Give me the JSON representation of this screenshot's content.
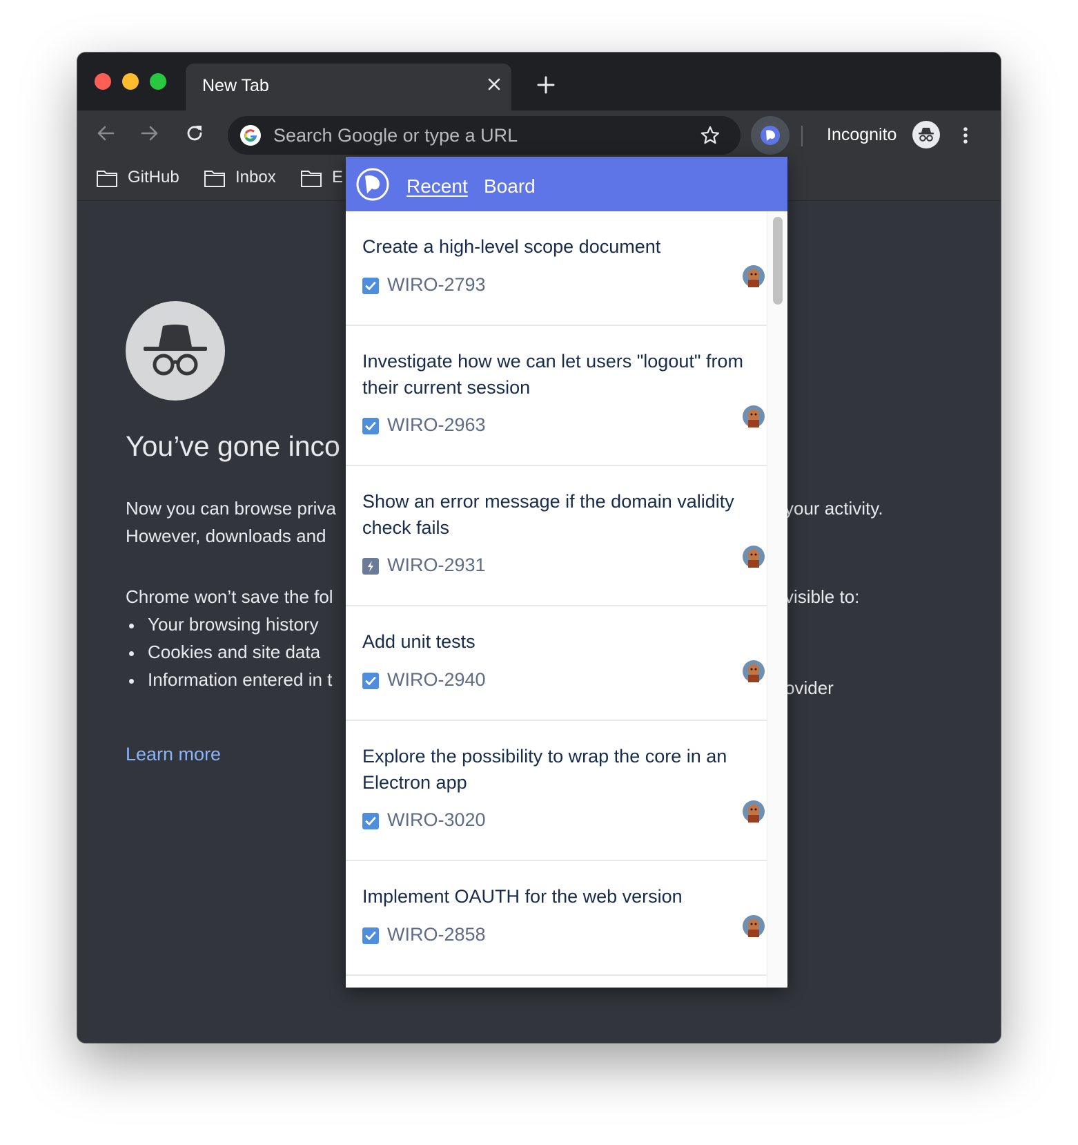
{
  "browser": {
    "tab_title": "New Tab",
    "omnibox_placeholder": "Search Google or type a URL",
    "profile_label": "Incognito",
    "icons": {
      "close": "close-icon",
      "new_tab": "plus-icon",
      "back": "back-arrow-icon",
      "forward": "forward-arrow-icon",
      "reload": "reload-icon",
      "search_engine": "google-g-icon",
      "bookmark": "star-icon",
      "extension": "extension-logo-icon",
      "profile": "incognito-icon",
      "menu": "vertical-dots-icon"
    },
    "bookmarks": [
      {
        "label": "GitHub",
        "icon": "folder-icon"
      },
      {
        "label": "Inbox",
        "icon": "folder-icon"
      },
      {
        "label": "E",
        "icon": "folder-icon"
      }
    ]
  },
  "page": {
    "headline": "You’ve gone inco",
    "para1": "Now you can browse priva",
    "para1_right": "your activity.",
    "para2": "However, downloads and",
    "para3": "Chrome won’t save the fol",
    "para3_right": "visible to:",
    "bullets": [
      "Your browsing history",
      "Cookies and site data",
      "Information entered in t"
    ],
    "bullet3_right": "ovider",
    "learn_more": "Learn more"
  },
  "popup": {
    "tabs": {
      "recent": "Recent",
      "board": "Board"
    },
    "active_tab": "Recent",
    "accent_color": "#5d75e6",
    "issues": [
      {
        "title": "Create a high-level scope document",
        "key": "WIRO-2793",
        "type": "task"
      },
      {
        "title": "Investigate how we can let users \"logout\" from their current session",
        "key": "WIRO-2963",
        "type": "task"
      },
      {
        "title": "Show an error message if the domain validity check fails",
        "key": "WIRO-2931",
        "type": "sub-task"
      },
      {
        "title": "Add unit tests",
        "key": "WIRO-2940",
        "type": "task"
      },
      {
        "title": "Explore the possibility to wrap the core in an Electron app",
        "key": "WIRO-3020",
        "type": "task"
      },
      {
        "title": "Implement OAUTH for the web version",
        "key": "WIRO-2858",
        "type": "task"
      }
    ]
  }
}
